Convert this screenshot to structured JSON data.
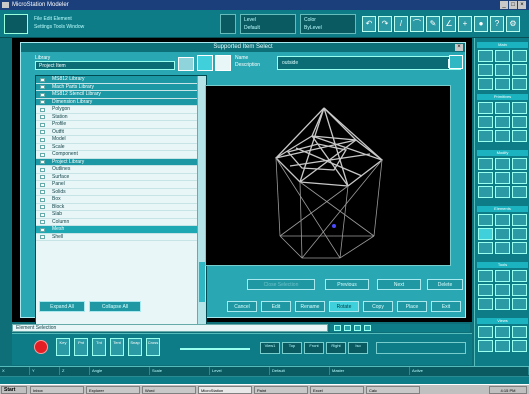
{
  "window": {
    "title": "MicroStation Modeler"
  },
  "dialog": {
    "title": "Supported Item Select",
    "name_label": "Name",
    "description_label": "Description",
    "name_value": "outside",
    "left_list": {
      "label": "Library",
      "dropdown_value": "Project Item",
      "items": [
        {
          "label": "MS812 Library",
          "kind": "section"
        },
        {
          "label": "Mach Parts Library",
          "kind": "section"
        },
        {
          "label": "MS812 Stencil Library",
          "kind": "section"
        },
        {
          "label": "Dimension Library",
          "kind": "section"
        },
        {
          "label": "Polygon",
          "kind": "item"
        },
        {
          "label": "Station",
          "kind": "item"
        },
        {
          "label": "Profile",
          "kind": "item"
        },
        {
          "label": "Outfit",
          "kind": "item"
        },
        {
          "label": "Model",
          "kind": "item"
        },
        {
          "label": "Scale",
          "kind": "item"
        },
        {
          "label": "Component",
          "kind": "item"
        },
        {
          "label": "Project Library",
          "kind": "section"
        },
        {
          "label": "Outlines",
          "kind": "item"
        },
        {
          "label": "Surface",
          "kind": "item"
        },
        {
          "label": "Panel",
          "kind": "item"
        },
        {
          "label": "Solids",
          "kind": "item"
        },
        {
          "label": "Box",
          "kind": "item"
        },
        {
          "label": "Block",
          "kind": "item"
        },
        {
          "label": "Slab",
          "kind": "item"
        },
        {
          "label": "Column",
          "kind": "item"
        },
        {
          "label": "Mesh",
          "kind": "selected"
        },
        {
          "label": "Shell",
          "kind": "item"
        }
      ]
    },
    "buttons": {
      "top_row": [
        "Close Selection",
        "Previous",
        "Next",
        "Delete"
      ],
      "bottom_left": [
        "Expand All",
        "Collapse All"
      ],
      "bottom_right": [
        "Cancel",
        "Edit",
        "Rename",
        "Rotate",
        "Copy",
        "Place",
        "Exit"
      ]
    }
  },
  "toolbar": {
    "line1": "File  Edit  Element",
    "line2": "Settings  Tools  Window",
    "level_label": "Level",
    "level_value": "Default",
    "color_label": "Color",
    "color_value": "ByLevel"
  },
  "command_line": {
    "prompt": "Element Selection"
  },
  "bottom_tools": [
    "Key",
    "Pnt",
    "Tnt",
    "Tent",
    "Snap",
    "Cross"
  ],
  "bottom_segments": [
    "View1",
    "Top",
    "Front",
    "Right",
    "Iso"
  ],
  "status": {
    "cells": [
      "X",
      "Y",
      "Z",
      "Angle",
      "Scale",
      "Level",
      "Default",
      "Master",
      "Active"
    ]
  },
  "right_panel": {
    "headers": [
      "Main",
      "Primitives",
      "Modify",
      "Elements",
      "Tools",
      "Views"
    ]
  },
  "taskbar": {
    "start_label": "Start",
    "tasks": [
      "Inbox",
      "Explorer",
      "Word",
      "MicroStation",
      "Paint",
      "Excel",
      "Calc"
    ],
    "clock": "4:15 PM"
  },
  "colors": {
    "accent": "#1ea8b4",
    "app_bg": "#0f6f79",
    "record": "#e21d24",
    "preview_bg": "#000000"
  }
}
